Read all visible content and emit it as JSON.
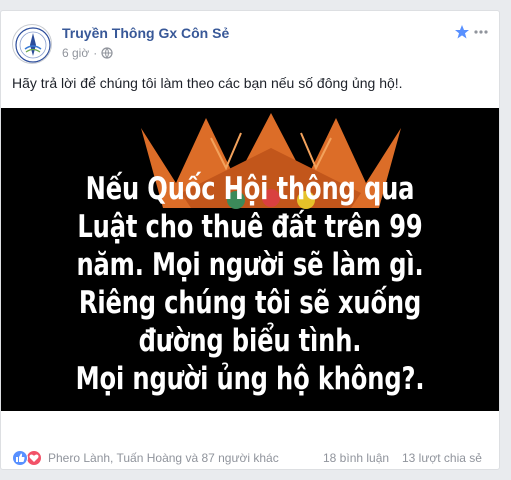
{
  "post": {
    "page_name": "Truyền Thông Gx Côn Sẻ",
    "time": "6 giờ",
    "text": "Hãy trả lời để chúng tôi làm theo các bạn nếu số đông ủng hộ!.",
    "audience_icon": "globe-icon"
  },
  "image": {
    "lines": [
      "Nếu Quốc Hội thông qua",
      "Luật cho thuê đất trên 99",
      "năm. Mọi người sẽ làm gì.",
      "Riêng chúng tôi sẽ xuống",
      "đường biểu tình.",
      "Mọi người ủng hộ không?."
    ]
  },
  "footer": {
    "reactors": "Phero Lành, Tuấn Hoàng và 87 người khác",
    "comments": "18 bình luận",
    "shares": "13 lượt chia sẻ"
  },
  "colors": {
    "link": "#385898",
    "secondary_text": "#90949c",
    "like": "#5890ff",
    "love": "#f25268",
    "star": "#5890ff"
  }
}
